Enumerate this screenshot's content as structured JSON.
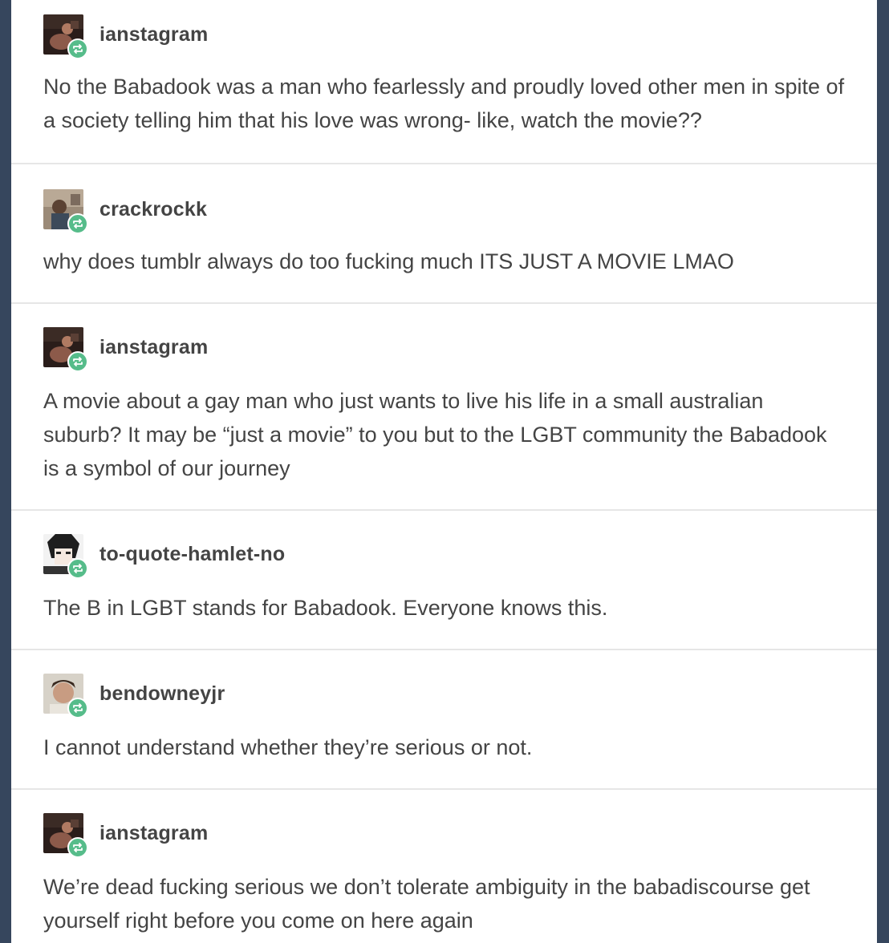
{
  "posts": [
    {
      "username": "ianstagram",
      "avatar": "ianstagram-avatar",
      "text": "No the Babadook was a man who fearlessly and proudly loved other men in spite of a society telling him that his love was wrong- like, watch the movie??"
    },
    {
      "username": "crackrockk",
      "avatar": "crackrockk-avatar",
      "text": "why does tumblr always do too fucking much ITS JUST A MOVIE LMAO"
    },
    {
      "username": "ianstagram",
      "avatar": "ianstagram-avatar",
      "text": "A movie about a gay man who just wants to live his life in a small australian suburb? It may be “just a movie” to you but to the LGBT community the Babadook is a symbol of our journey"
    },
    {
      "username": "to-quote-hamlet-no",
      "avatar": "to-quote-hamlet-no-avatar",
      "text": "The B in LGBT stands for Babadook. Everyone knows this."
    },
    {
      "username": "bendowneyjr",
      "avatar": "bendowneyjr-avatar",
      "text": "I cannot understand whether they’re serious or not."
    },
    {
      "username": "ianstagram",
      "avatar": "ianstagram-avatar",
      "text": "We’re dead fucking serious we don’t tolerate ambiguity in the babadiscourse get yourself right before you come on here again"
    }
  ],
  "icons": {
    "reblog": "reblog-icon"
  },
  "colors": {
    "background": "#36465d",
    "card": "#ffffff",
    "text": "#444444",
    "reblog_badge": "#56bc8a"
  }
}
